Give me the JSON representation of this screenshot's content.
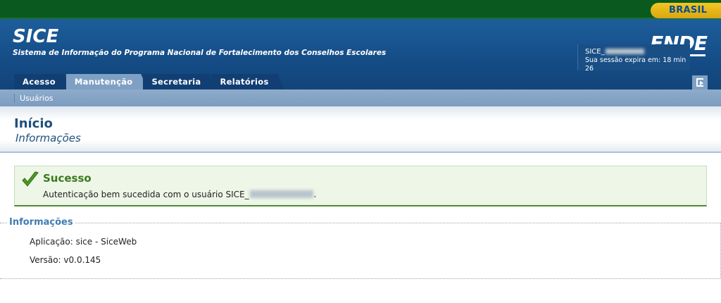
{
  "gov_bar": {
    "badge": "BRASIL"
  },
  "header": {
    "title": "SICE",
    "subtitle": "Sistema de Informação do Programa Nacional de Fortalecimento dos Conselhos Escolares",
    "logo": "FNDE"
  },
  "tabs": [
    {
      "label": "Acesso",
      "active": false
    },
    {
      "label": "Manutenção",
      "active": true
    },
    {
      "label": "Secretaria",
      "active": false
    },
    {
      "label": "Relatórios",
      "active": false
    }
  ],
  "session": {
    "user": "SICE_",
    "expires": "Sua sessão expira em: 18 min 26"
  },
  "submenu": {
    "items": [
      "Usuários"
    ]
  },
  "page": {
    "title": "Início",
    "subtitle": "Informações"
  },
  "message": {
    "title": "Sucesso",
    "text": "Autenticação bem sucedida com o usuário SICE_",
    "suffix": "."
  },
  "info": {
    "legend": "Informações",
    "application": "Aplicação: sice - SiceWeb",
    "version": "Versão: v0.0.145"
  },
  "colors": {
    "gov_green": "#0a5a1f",
    "header_blue": "#154c86",
    "tab_dark": "#123f73",
    "tab_active": "#7fa0c4",
    "success_green": "#3a7a1e"
  },
  "icons": [
    "logout-icon",
    "checkmark-icon"
  ]
}
